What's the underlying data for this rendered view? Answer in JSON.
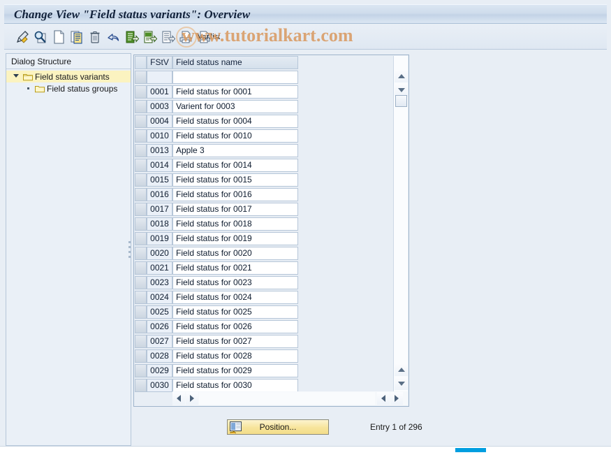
{
  "window": {
    "title": "Change View \"Field status variants\": Overview"
  },
  "watermark": {
    "text": "www.tutorialkart.com"
  },
  "toolbar": {
    "varlist_label": "Var.list",
    "buttons": [
      {
        "name": "edit-pencil-icon",
        "tooltip": "Display/Change"
      },
      {
        "name": "search-document-icon",
        "tooltip": "Check"
      },
      {
        "name": "new-entries-icon",
        "tooltip": "New Entries"
      },
      {
        "name": "copy-as-icon",
        "tooltip": "Copy As"
      },
      {
        "name": "delete-trash-icon",
        "tooltip": "Delete"
      },
      {
        "name": "undo-icon",
        "tooltip": "Undo Change"
      },
      {
        "name": "select-all-icon",
        "tooltip": "Select All"
      },
      {
        "name": "select-block-icon",
        "tooltip": "Select Block"
      },
      {
        "name": "deselect-all-icon",
        "tooltip": "Deselect All"
      },
      {
        "name": "print-preview-icon",
        "tooltip": "Print"
      },
      {
        "name": "variant-list-icon",
        "tooltip": "Variant List"
      }
    ]
  },
  "sidebar": {
    "title": "Dialog Structure",
    "items": [
      {
        "label": "Field status variants",
        "selected": true,
        "expanded": true,
        "level": 0
      },
      {
        "label": "Field status groups",
        "selected": false,
        "expanded": false,
        "level": 1
      }
    ]
  },
  "table": {
    "columns": [
      {
        "key": "fstv",
        "label": "FStV"
      },
      {
        "key": "name",
        "label": "Field status name"
      }
    ],
    "rows": [
      {
        "fstv": "",
        "name": ""
      },
      {
        "fstv": "0001",
        "name": "Field status for 0001"
      },
      {
        "fstv": "0003",
        "name": "Varient for 0003"
      },
      {
        "fstv": "0004",
        "name": "Field status for 0004"
      },
      {
        "fstv": "0010",
        "name": "Field status for 0010"
      },
      {
        "fstv": "0013",
        "name": "Apple 3"
      },
      {
        "fstv": "0014",
        "name": "Field status for 0014"
      },
      {
        "fstv": "0015",
        "name": "Field status for 0015"
      },
      {
        "fstv": "0016",
        "name": "Field status for 0016"
      },
      {
        "fstv": "0017",
        "name": "Field status for 0017"
      },
      {
        "fstv": "0018",
        "name": "Field status for 0018"
      },
      {
        "fstv": "0019",
        "name": "Field status for 0019"
      },
      {
        "fstv": "0020",
        "name": "Field status for 0020"
      },
      {
        "fstv": "0021",
        "name": "Field status for 0021"
      },
      {
        "fstv": "0023",
        "name": "Field status for 0023"
      },
      {
        "fstv": "0024",
        "name": "Field status for 0024"
      },
      {
        "fstv": "0025",
        "name": "Field status for 0025"
      },
      {
        "fstv": "0026",
        "name": "Field status for 0026"
      },
      {
        "fstv": "0027",
        "name": "Field status for 0027"
      },
      {
        "fstv": "0028",
        "name": "Field status for 0028"
      },
      {
        "fstv": "0029",
        "name": "Field status for 0029"
      },
      {
        "fstv": "0030",
        "name": "Field status for 0030"
      }
    ]
  },
  "footer": {
    "position_button_label": "Position...",
    "entry_count_text": "Entry 1 of 296"
  },
  "colors": {
    "title_bar": "#cfdcec",
    "selection_highlight": "#fbf3c0",
    "button_yellow": "#f7e49b",
    "watermark": "#d99b63",
    "accent_blue": "#009ee0"
  }
}
